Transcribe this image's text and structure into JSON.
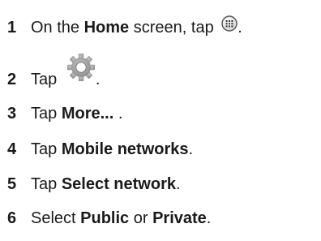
{
  "steps": [
    {
      "num": "1",
      "pre": "On the ",
      "bold": "Home",
      "post": " screen, tap ",
      "icon": "apps-grid-icon",
      "end": "."
    },
    {
      "num": "2",
      "pre": "Tap ",
      "icon": "settings-gear-icon",
      "end": "."
    },
    {
      "num": "3",
      "pre": "Tap ",
      "bold": "More...",
      "end": " ."
    },
    {
      "num": "4",
      "pre": "Tap ",
      "bold": "Mobile networks",
      "end": "."
    },
    {
      "num": "5",
      "pre": "Tap ",
      "bold": "Select network",
      "end": "."
    },
    {
      "num": "6",
      "pre": "Select ",
      "bold": "Public",
      "mid": " or ",
      "bold2": "Private",
      "end": "."
    }
  ]
}
